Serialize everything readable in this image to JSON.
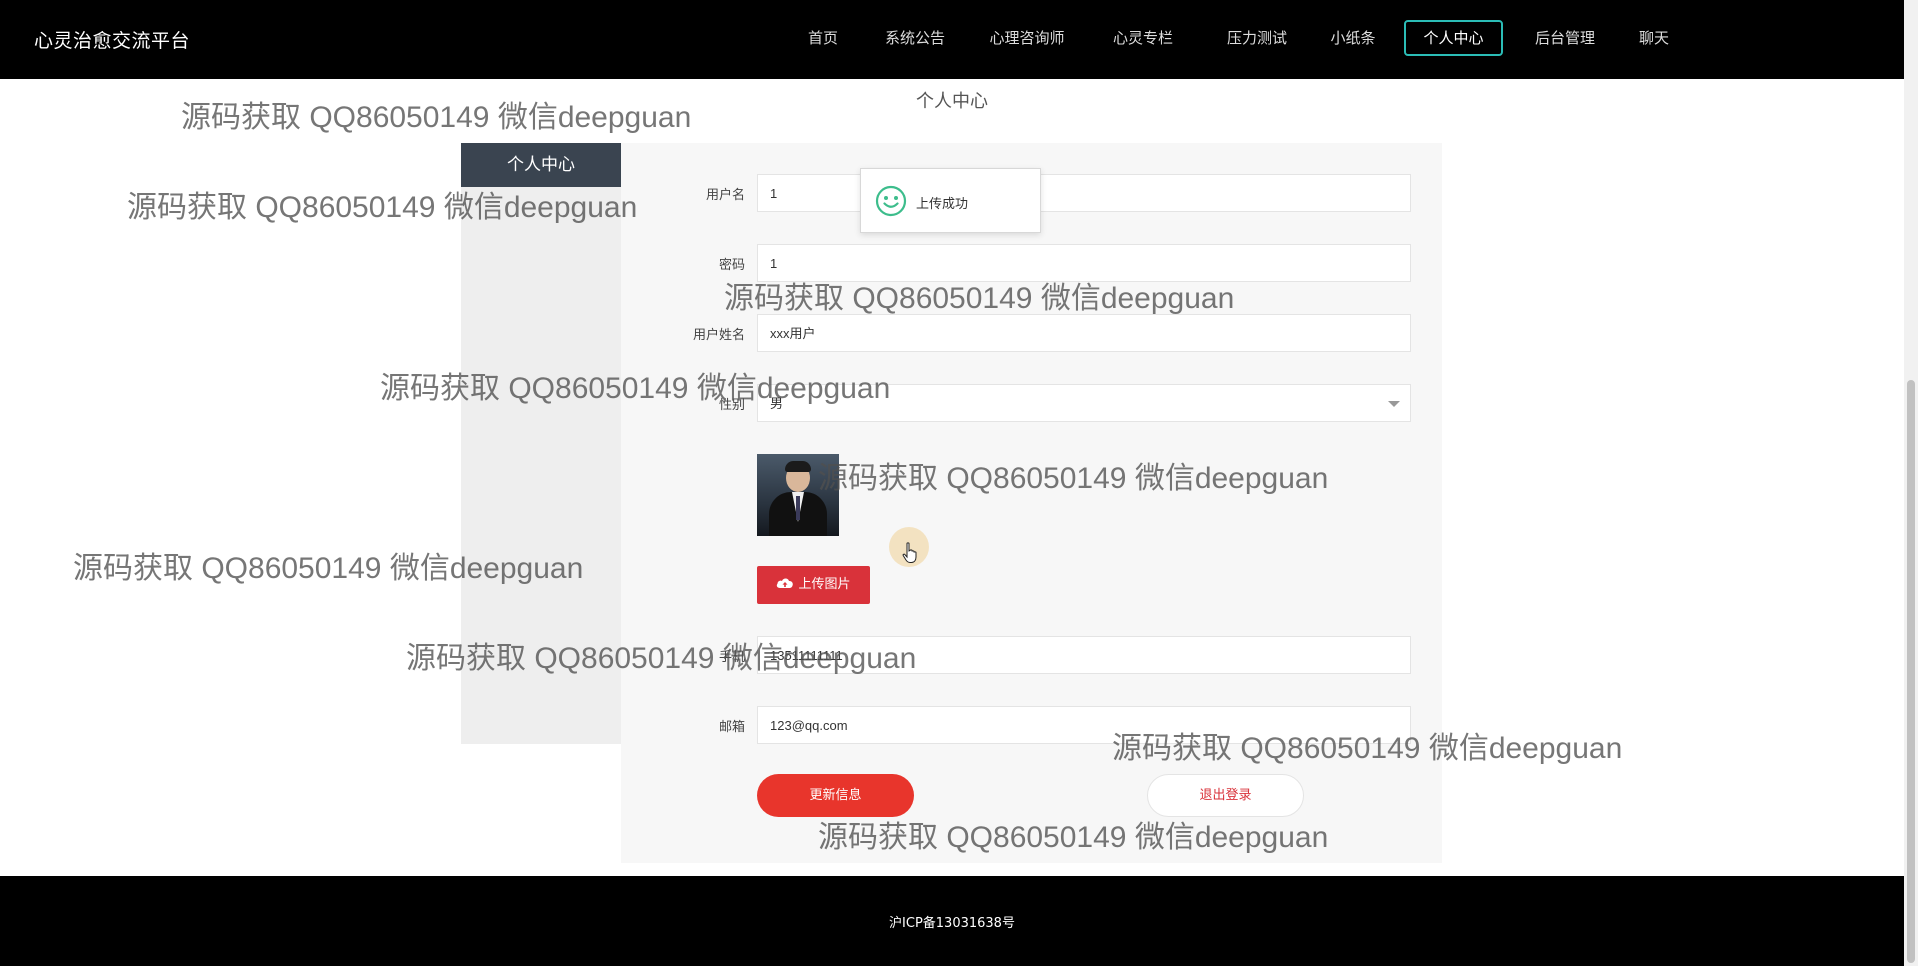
{
  "header": {
    "brand": "心灵治愈交流平台",
    "nav": [
      {
        "label": "首页",
        "active": false
      },
      {
        "label": "系统公告",
        "active": false
      },
      {
        "label": "心理咨询师",
        "active": false
      },
      {
        "label": "心灵专栏",
        "active": false
      },
      {
        "label": "压力测试",
        "active": false
      },
      {
        "label": "小纸条",
        "active": false
      },
      {
        "label": "个人中心",
        "active": true
      },
      {
        "label": "后台管理",
        "active": false
      },
      {
        "label": "聊天",
        "active": false
      }
    ]
  },
  "main": {
    "heading": "个人中心",
    "sidebar_title": "个人中心",
    "form": {
      "username": {
        "label": "用户名",
        "value": "1"
      },
      "password": {
        "label": "密码",
        "value": "1"
      },
      "fullname": {
        "label": "用户姓名",
        "value": "xxx用户"
      },
      "gender": {
        "label": "性别",
        "value": "男"
      },
      "upload_label": "上传图片",
      "phone": {
        "label": "手机",
        "value": "13511111111"
      },
      "email": {
        "label": "邮箱",
        "value": "123@qq.com"
      },
      "update_button": "更新信息",
      "logout_button": "退出登录"
    },
    "toast": {
      "message": "上传成功",
      "icon": "smile-icon"
    }
  },
  "footer": {
    "icp": "沪ICP备13031638号"
  },
  "watermark_text": "源码获取 QQ86050149 微信deepguan",
  "colors": {
    "header_bg": "#000000",
    "accent_teal": "#2bbcb6",
    "sidebar_title_bg": "#3a4450",
    "button_red": "#e8352c",
    "upload_red": "#d9323a",
    "toast_icon_green": "#3dbd8c"
  }
}
